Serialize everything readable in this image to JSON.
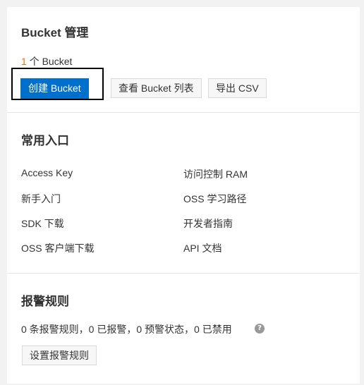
{
  "bucket_section": {
    "title": "Bucket 管理",
    "count_value": "1",
    "count_unit": "个 Bucket",
    "buttons": {
      "create": "创建 Bucket",
      "view_list": "查看 Bucket 列表",
      "export_csv": "导出 CSV"
    }
  },
  "common_section": {
    "title": "常用入口",
    "links_left": [
      "Access Key",
      "新手入门",
      "SDK 下载",
      "OSS 客户端下载"
    ],
    "links_right": [
      "访问控制 RAM",
      "OSS 学习路径",
      "开发者指南",
      "API 文档"
    ]
  },
  "alarm_section": {
    "title": "报警规则",
    "summary": "0 条报警规则，0 已报警，0 预警状态，0 已禁用",
    "help_icon": "question-circle-icon",
    "button": "设置报警规则"
  },
  "colors": {
    "primary": "#0070cc",
    "accent_count": "#ff6a00",
    "panel_bg": "#ffffff",
    "page_bg": "#f2f2f2"
  }
}
